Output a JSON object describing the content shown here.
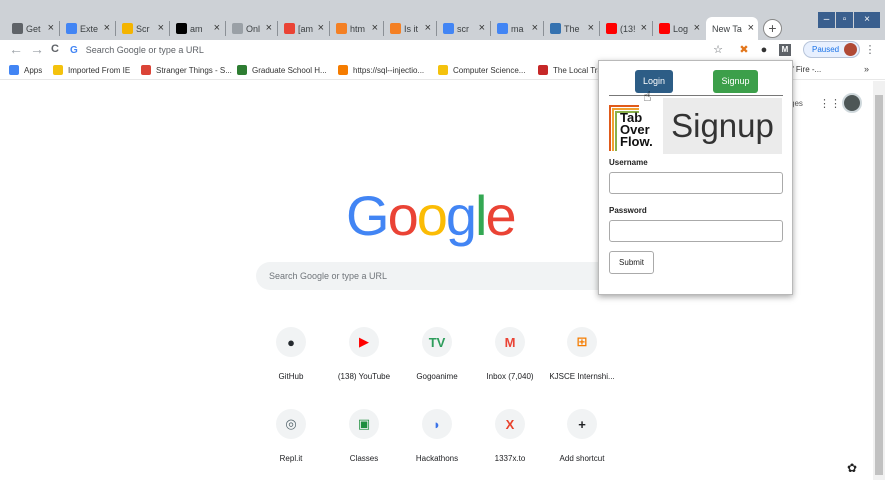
{
  "browser": {
    "tabs": [
      {
        "title": "Get",
        "icon": "gmail-icon",
        "color": "#5f6368"
      },
      {
        "title": "Exte",
        "icon": "puzzle-icon",
        "color": "#4285f4"
      },
      {
        "title": "Scr",
        "icon": "chrome-icon",
        "color": "#f4b400"
      },
      {
        "title": "am",
        "icon": "github-icon",
        "color": "#000000"
      },
      {
        "title": "Onl",
        "icon": "page-icon",
        "color": "#9aa0a6"
      },
      {
        "title": "[am",
        "icon": "gmail-icon",
        "color": "#ea4335"
      },
      {
        "title": "htm",
        "icon": "stack-icon",
        "color": "#f48024"
      },
      {
        "title": "Is it",
        "icon": "stack-icon",
        "color": "#f48024"
      },
      {
        "title": "scr",
        "icon": "google-icon",
        "color": "#4285f4"
      },
      {
        "title": "ma",
        "icon": "google-icon",
        "color": "#4285f4"
      },
      {
        "title": "The",
        "icon": "trello-icon",
        "color": "#3572b0"
      },
      {
        "title": "(13!",
        "icon": "youtube-icon",
        "color": "#ff0000"
      },
      {
        "title": "Log",
        "icon": "youtube-icon",
        "color": "#ff0000"
      },
      {
        "title": "New Ta",
        "icon": "none",
        "color": "#ffffff"
      }
    ],
    "new_tab_symbol": "+",
    "omnibox_placeholder": "Search Google or type a URL",
    "paused_label": "Paused",
    "back_symbol": "←",
    "forward_symbol": "→",
    "reload_symbol": "C",
    "star_symbol": "☆",
    "menu_symbol": "⋮",
    "close_symbol": "×"
  },
  "bookmarks": [
    {
      "label": "Apps",
      "color": "#4285f4"
    },
    {
      "label": "Imported From IE",
      "color": "#f4c20d"
    },
    {
      "label": "Stranger Things - S...",
      "color": "#db4437"
    },
    {
      "label": "Graduate School H...",
      "color": "#2e7d32"
    },
    {
      "label": "https://sql--injectio...",
      "color": "#f57c00"
    },
    {
      "label": "Computer Science...",
      "color": "#f4c20d"
    },
    {
      "label": "The Local Tra",
      "color": "#c62828"
    },
    {
      "label": "of Fire -...",
      "color": "#ffffff"
    }
  ],
  "bookmarks_more": "»",
  "newtab": {
    "logo_letters": [
      {
        "ch": "G",
        "color": "#4285f4"
      },
      {
        "ch": "o",
        "color": "#ea4335"
      },
      {
        "ch": "o",
        "color": "#fbbc05"
      },
      {
        "ch": "g",
        "color": "#4285f4"
      },
      {
        "ch": "l",
        "color": "#34a853"
      },
      {
        "ch": "e",
        "color": "#ea4335"
      }
    ],
    "search_placeholder": "Search Google or type a URL",
    "images_link": "ges",
    "shortcuts": [
      {
        "label": "GitHub",
        "glyph": "●",
        "color": "#24292e"
      },
      {
        "label": "(138) YouTube",
        "glyph": "▶",
        "color": "#ff0000"
      },
      {
        "label": "Gogoanime",
        "glyph": "TV",
        "color": "#2e9d5c"
      },
      {
        "label": "Inbox (7,040)",
        "glyph": "M",
        "color": "#ea4335"
      },
      {
        "label": "KJSCE Internshi...",
        "glyph": "⊞",
        "color": "#f57c00"
      },
      {
        "label": "Repl.it",
        "glyph": "◎",
        "color": "#56676e"
      },
      {
        "label": "Classes",
        "glyph": "▣",
        "color": "#1e8e3e"
      },
      {
        "label": "Hackathons",
        "glyph": "◗",
        "color": "#3b73e8"
      },
      {
        "label": "1337x.to",
        "glyph": "X",
        "color": "#e8412b"
      },
      {
        "label": "Add shortcut",
        "glyph": "+",
        "color": "#202124"
      }
    ]
  },
  "popup": {
    "login_label": "Login",
    "signup_label": "Signup",
    "login_color": "#2d5d86",
    "signup_color": "#3c9f4a",
    "logo_lines": [
      "Tab",
      "Over",
      "Flow."
    ],
    "heading": "Signup",
    "username_label": "Username",
    "password_label": "Password",
    "submit_label": "Submit"
  }
}
